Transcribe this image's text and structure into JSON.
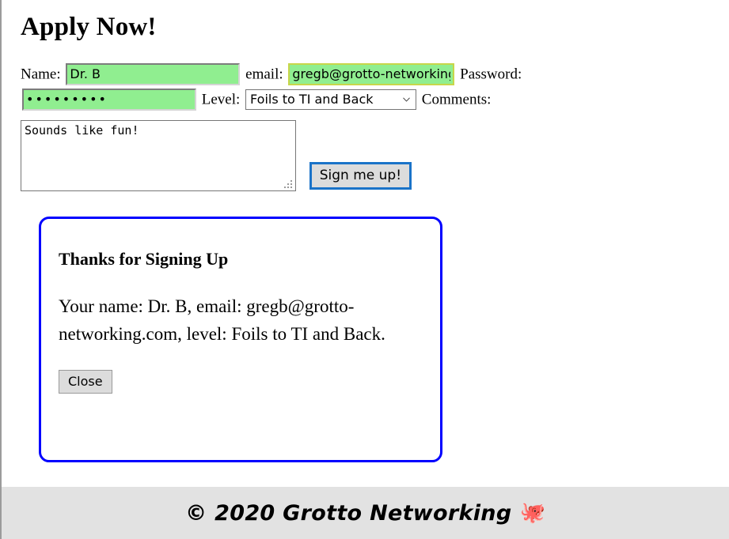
{
  "page": {
    "title": "Apply Now!"
  },
  "form": {
    "name_label": "Name:",
    "name_value": "Dr. B",
    "name_placeholder": "",
    "email_label": "email:",
    "email_value": "gregb@grotto-networking.com",
    "email_placeholder": "",
    "password_label": "Password:",
    "password_value": "secretpwd",
    "password_placeholder": "",
    "level_label": "Level:",
    "level_selected": "Foils to TI and Back",
    "level_options": [
      "Foils to TI and Back"
    ],
    "comments_label": "Comments:",
    "comments_value": "Sounds like fun!",
    "comments_placeholder": "",
    "submit_label": "Sign me up!"
  },
  "modal": {
    "heading": "Thanks for Signing Up",
    "body": "Your name: Dr. B, email: gregb@grotto-networking.com, level: Foils to TI and Back.",
    "close_label": "Close"
  },
  "footer": {
    "copyright": "© 2020 Grotto Networking",
    "emoji": "🐙"
  },
  "colors": {
    "input_fill": "#90ee90",
    "email_outline": "#c8d64a",
    "modal_border": "#0000ff",
    "focus_ring": "#1a73c8",
    "footer_bg": "#e2e2e2"
  }
}
